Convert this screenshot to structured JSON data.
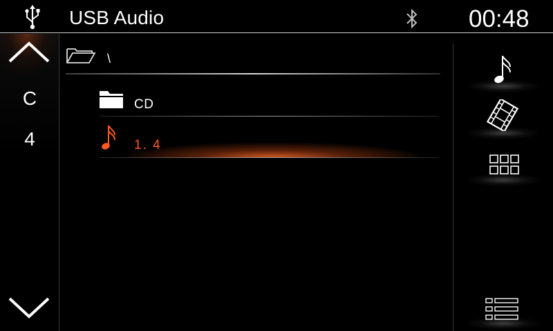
{
  "header": {
    "source_icon": "usb-icon",
    "title": "USB Audio",
    "bluetooth_icon": "bluetooth-icon",
    "clock": "00:48"
  },
  "left_rail": {
    "up_icon": "chevron-up-icon",
    "jump_items": [
      "C",
      "4"
    ],
    "down_icon": "chevron-down-icon"
  },
  "path": {
    "icon": "open-folder-icon",
    "text": "\\"
  },
  "list": {
    "items": [
      {
        "type": "folder",
        "icon": "folder-icon",
        "label": "CD"
      },
      {
        "type": "song",
        "icon": "music-note-icon",
        "label": "1. 4",
        "selected": true
      }
    ]
  },
  "right_rail": {
    "buttons": [
      {
        "name": "music",
        "icon": "music-note-icon"
      },
      {
        "name": "video",
        "icon": "film-icon"
      },
      {
        "name": "grid",
        "icon": "grid-icon"
      },
      {
        "name": "list",
        "icon": "list-icon"
      }
    ]
  },
  "colors": {
    "background": "#000000",
    "text": "#ffffff",
    "accent": "#ff5a22"
  }
}
